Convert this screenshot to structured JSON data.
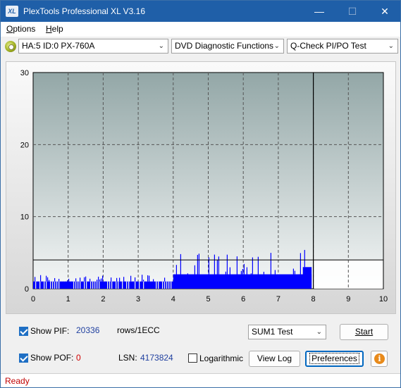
{
  "window": {
    "title": "PlexTools Professional XL V3.16",
    "icon_text": "XL",
    "controls": {
      "minimize": "—",
      "maximize": "☐",
      "close": "✕"
    }
  },
  "menu": {
    "items": [
      {
        "label": "Options",
        "mnemonic": "O",
        "rest": "ptions"
      },
      {
        "label": "Help",
        "mnemonic": "H",
        "rest": "elp"
      }
    ]
  },
  "toolbar": {
    "drive_icon": "disc-icon",
    "drive_select": "HA:5 ID:0  PX-760A",
    "function_select": "DVD Diagnostic Functions",
    "test_select": "Q-Check PI/PO Test"
  },
  "chart_data": {
    "type": "bar",
    "series": [
      {
        "name": "PIF",
        "color": "#0000ff"
      }
    ],
    "xlim": [
      0,
      10
    ],
    "ylim": [
      0,
      30
    ],
    "x_ticks": [
      "0",
      "1",
      "2",
      "3",
      "4",
      "5",
      "6",
      "7",
      "8",
      "9",
      "10"
    ],
    "y_ticks": [
      "0",
      "10",
      "20",
      "30"
    ],
    "threshold_line": 4,
    "end_marker_x": 8,
    "segments": [
      {
        "x_start": 0.0,
        "x_end": 4.0,
        "base": 1,
        "spike_max": 2
      },
      {
        "x_start": 4.0,
        "x_end": 7.95,
        "base": 2,
        "spike_max": 5
      },
      {
        "x_start": 7.7,
        "x_end": 7.95,
        "base": 3,
        "spike_max": 6
      }
    ],
    "grid": true
  },
  "bottom": {
    "show_pif_label": "Show PIF:",
    "show_pif_checked": true,
    "pif_value": "20336",
    "pif_unit": "rows/1ECC",
    "show_pof_label": "Show POF:",
    "show_pof_checked": true,
    "pof_value": "0",
    "lsn_label": "LSN:",
    "lsn_value": "4173824",
    "logarithmic_label": "Logarithmic",
    "logarithmic_checked": false,
    "sum_select": "SUM1 Test",
    "start_label": "Start",
    "viewlog_label": "View Log",
    "preferences_label": "Preferences",
    "info_icon": "info-icon"
  },
  "status": {
    "text": "Ready"
  },
  "colors": {
    "accent": "#1f5fa8",
    "pif_value": "#1f3f9f",
    "pof_value": "#d00000",
    "status": "#c00000"
  }
}
